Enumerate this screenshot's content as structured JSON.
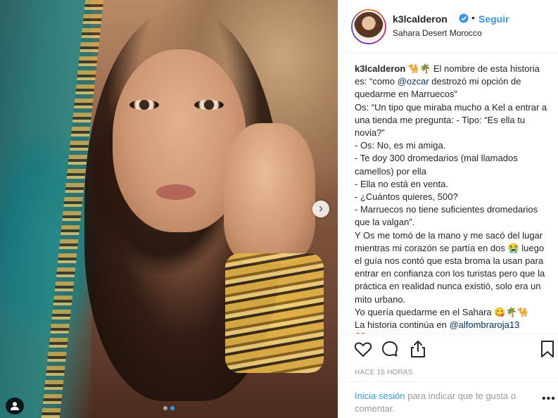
{
  "post": {
    "username": "k3lcalderon",
    "follow_label": "Seguir",
    "dot": "•",
    "location": "Sahara Desert Morocco",
    "caption_lines": [
      "🐪🌴 El nombre de esta historia es: “como @ozcar destrozó mi opción de quedarme en Marruecos”",
      "Os: “Un tipo que miraba mucho a Kel a entrar a una tienda me pregunta: - Tipo: “Es ella tu novia?”",
      "- Os: No, es mi amiga.",
      "- Te doy 300 dromedarios (mal llamados camellos) por ella",
      "- Ella no está en venta.",
      "- ¿Cuántos quieres, 500?",
      "- Marruecos no tiene suficientes dromedarios que la valgan”.",
      "Y Os me tomó de la mano y me sacó del lugar mientras mi corazón se partía en dos 😭 luego el guía nos contó que esta broma la usan para entrar en confianza con los turistas pero que la práctica en realidad nunca existió, solo era un mito urbano.",
      "Yo quería quedarme en el Sahara 😋🌴🐪",
      "La historia continúa en @alfombraroja13",
      "❤️"
    ],
    "timestamp": "HACE 15 HORAS",
    "login_link": "Inicia sesión",
    "login_text": " para indicar que te gusta o comentar.",
    "more_label": "•••",
    "carousel_next": "›",
    "carousel": {
      "count": 2,
      "active": 1
    }
  },
  "colors": {
    "accent": "#3897f0",
    "mention": "#003569",
    "muted": "#999999"
  },
  "icons": [
    "verified-badge-icon",
    "heart-icon",
    "comment-icon",
    "share-icon",
    "bookmark-icon",
    "user-tag-icon",
    "chevron-right-icon",
    "more-options-icon"
  ]
}
